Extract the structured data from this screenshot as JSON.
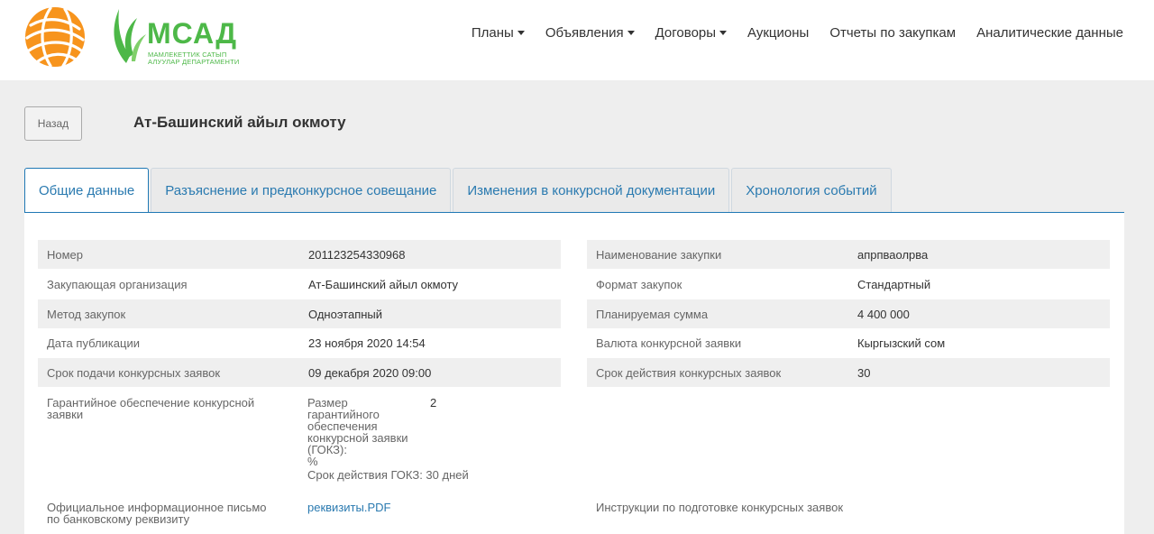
{
  "brand": {
    "title": "МСАД",
    "subtitle_line1": "МАМЛЕКЕТТИК САТЫП",
    "subtitle_line2": "АЛУУЛАР ДЕПАРТАМЕНТИ"
  },
  "nav": {
    "plans": "Планы",
    "announcements": "Объявления",
    "contracts": "Договоры",
    "auctions": "Аукционы",
    "reports": "Отчеты по закупкам",
    "analytics": "Аналитические данные"
  },
  "back_label": "Назад",
  "org_title": "Ат-Башинский айыл окмоту",
  "tabs": [
    {
      "label": "Общие данные"
    },
    {
      "label": "Разъяснение и предконкурсное совещание"
    },
    {
      "label": "Изменения в конкурсной документации"
    },
    {
      "label": "Хронология событий"
    }
  ],
  "left": {
    "number_label": "Номер",
    "number_value": "201123254330968",
    "org_label": "Закупающая организация",
    "org_value": "Ат-Башинский айыл окмоту",
    "method_label": "Метод закупок",
    "method_value": "Одноэтапный",
    "pub_label": "Дата публикации",
    "pub_value": "23 ноября 2020 14:54",
    "deadline_label": "Срок подачи конкурсных заявок",
    "deadline_value": "09 декабря 2020 09:00",
    "guarantee_label_1": "Гарантийное обеспечение конкурсной",
    "guarantee_label_2": "заявки",
    "gok_l1": "Размер",
    "gok_l2": "гарантийного",
    "gok_l3": "обеспечения",
    "gok_l4": "конкурсной заявки",
    "gok_l5": "(ГОКЗ):",
    "gok_l6": "%",
    "gok_value": "2",
    "gok_term": "Срок действия ГОКЗ: 30 дней",
    "letter_label_1": "Официальное информационное письмо",
    "letter_label_2": "по банковскому реквизиту",
    "letter_link": "реквизиты.PDF"
  },
  "right": {
    "name_label": "Наименование закупки",
    "name_value": "апрпваолрва",
    "format_label": "Формат закупок",
    "format_value": "Стандартный",
    "sum_label": "Планируемая сумма",
    "sum_value": "4 400 000",
    "currency_label": "Валюта конкурсной заявки",
    "currency_value": "Кыргызский сом",
    "validity_label": "Срок действия конкурсных заявок",
    "validity_value": "30",
    "instructions_label": "Инструкции по подготовке конкурсных заявок"
  },
  "colors": {
    "brand_green": "#4db848",
    "link_blue": "#2a7ab0",
    "globe_orange": "#f7931e"
  }
}
